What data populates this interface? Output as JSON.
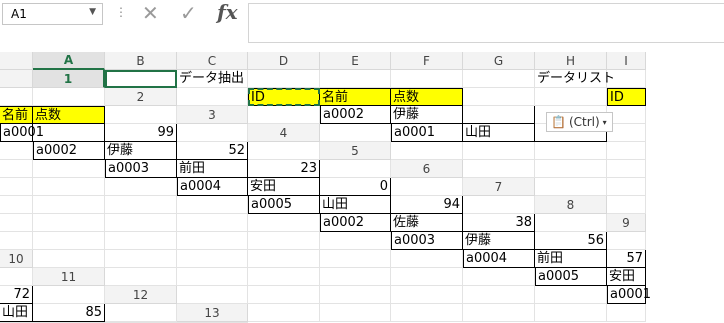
{
  "formula_bar": {
    "name_box": "A1",
    "cancel_icon": "✕",
    "enter_icon": "✓",
    "fx_label": "fx",
    "formula": ""
  },
  "columns": [
    "A",
    "B",
    "C",
    "D",
    "E",
    "F",
    "G",
    "H",
    "I"
  ],
  "rows": [
    "1",
    "2",
    "3",
    "4",
    "5",
    "6",
    "7",
    "8",
    "9",
    "10",
    "11",
    "12",
    "13"
  ],
  "extract": {
    "title": "データ抽出",
    "headers": [
      "ID",
      "名前",
      "点数"
    ],
    "rows": [
      [
        "a0002",
        "伊藤",
        ""
      ],
      [
        "a0001",
        "山田",
        ""
      ]
    ]
  },
  "datalist": {
    "title": "データリスト",
    "headers": [
      "ID",
      "名前",
      "点数"
    ],
    "rows": [
      [
        "a0001",
        "",
        "99"
      ],
      [
        "a0002",
        "伊藤",
        "52"
      ],
      [
        "a0003",
        "前田",
        "23"
      ],
      [
        "a0004",
        "安田",
        "0"
      ],
      [
        "a0005",
        "山田",
        "94"
      ],
      [
        "a0002",
        "佐藤",
        "38"
      ],
      [
        "a0003",
        "伊藤",
        "56"
      ],
      [
        "a0004",
        "前田",
        "57"
      ],
      [
        "a0005",
        "安田",
        "72"
      ],
      [
        "a0001",
        "山田",
        "85"
      ]
    ]
  },
  "paste_options": {
    "label": "(Ctrl)",
    "arrow": "▾"
  },
  "colors": {
    "accent": "#217346",
    "highlight": "#ffff00"
  }
}
